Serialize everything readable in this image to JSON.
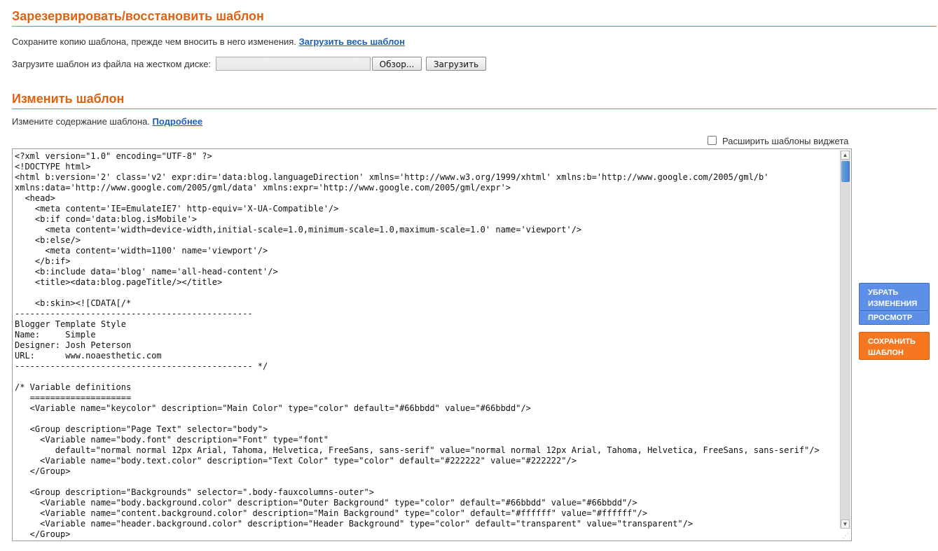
{
  "backup_section": {
    "title": "Зарезервировать/восстановить шаблон",
    "copy_text": "Сохраните копию шаблона, прежде чем вносить в него изменения.",
    "download_link": "Загрузить весь шаблон",
    "upload_label": "Загрузите шаблон из файла на жестком диске:",
    "browse_button": "Обзор...",
    "upload_button": "Загрузить"
  },
  "edit_section": {
    "title": "Изменить шаблон",
    "desc": "Измените содержание шаблона.",
    "more_link": "Подробнее",
    "expand_widgets_label": "Расширить шаблоны виджета",
    "expand_widgets_checked": false
  },
  "editor": {
    "code": "<?xml version=\"1.0\" encoding=\"UTF-8\" ?>\n<!DOCTYPE html>\n<html b:version='2' class='v2' expr:dir='data:blog.languageDirection' xmlns='http://www.w3.org/1999/xhtml' xmlns:b='http://www.google.com/2005/gml/b'\nxmlns:data='http://www.google.com/2005/gml/data' xmlns:expr='http://www.google.com/2005/gml/expr'>\n  <head>\n    <meta content='IE=EmulateIE7' http-equiv='X-UA-Compatible'/>\n    <b:if cond='data:blog.isMobile'>\n      <meta content='width=device-width,initial-scale=1.0,minimum-scale=1.0,maximum-scale=1.0' name='viewport'/>\n    <b:else/>\n      <meta content='width=1100' name='viewport'/>\n    </b:if>\n    <b:include data='blog' name='all-head-content'/>\n    <title><data:blog.pageTitle/></title>\n\n    <b:skin><![CDATA[/*\n-----------------------------------------------\nBlogger Template Style\nName:     Simple\nDesigner: Josh Peterson\nURL:      www.noaesthetic.com\n----------------------------------------------- */\n\n/* Variable definitions\n   ====================\n   <Variable name=\"keycolor\" description=\"Main Color\" type=\"color\" default=\"#66bbdd\" value=\"#66bbdd\"/>\n\n   <Group description=\"Page Text\" selector=\"body\">\n     <Variable name=\"body.font\" description=\"Font\" type=\"font\"\n        default=\"normal normal 12px Arial, Tahoma, Helvetica, FreeSans, sans-serif\" value=\"normal normal 12px Arial, Tahoma, Helvetica, FreeSans, sans-serif\"/>\n     <Variable name=\"body.text.color\" description=\"Text Color\" type=\"color\" default=\"#222222\" value=\"#222222\"/>\n   </Group>\n\n   <Group description=\"Backgrounds\" selector=\".body-fauxcolumns-outer\">\n     <Variable name=\"body.background.color\" description=\"Outer Background\" type=\"color\" default=\"#66bbdd\" value=\"#66bbdd\"/>\n     <Variable name=\"content.background.color\" description=\"Main Background\" type=\"color\" default=\"#ffffff\" value=\"#ffffff\"/>\n     <Variable name=\"header.background.color\" description=\"Header Background\" type=\"color\" default=\"transparent\" value=\"transparent\"/>\n   </Group>"
  },
  "side_buttons": {
    "revert": "УБРАТЬ ИЗМЕНЕНИЯ",
    "preview": "ПРОСМОТР",
    "save": "СОХРАНИТЬ ШАБЛОН"
  },
  "colors": {
    "heading": "#dd6211",
    "link": "#1c5fb5",
    "blue_button": "#5d8fe6",
    "orange_button": "#f57720"
  }
}
